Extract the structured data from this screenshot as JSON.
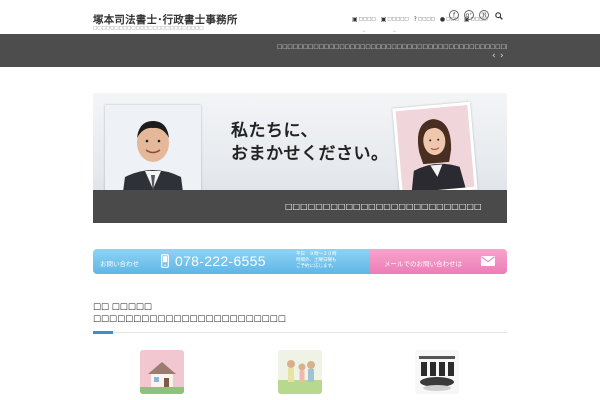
{
  "header": {
    "site_title": "塚本司法書士･行政書士事務所",
    "site_tagline": "□□□□□□□□□□□□□□□□□□□□□□□□□□",
    "nav": [
      {
        "label": "□□□□",
        "icon": "briefcase-icon",
        "glyph": "▣"
      },
      {
        "label": "□□□□□",
        "icon": "briefcase-icon",
        "glyph": "▣"
      },
      {
        "label": "□□□□",
        "icon": "question-icon",
        "glyph": "?"
      },
      {
        "label": "□□□",
        "icon": "info-icon",
        "glyph": "●"
      },
      {
        "label": "□□□□",
        "icon": "briefcase-icon",
        "glyph": "▣"
      }
    ],
    "social": [
      {
        "name": "facebook-icon",
        "glyph": "f"
      },
      {
        "name": "google-plus-icon",
        "glyph": "g⁺"
      },
      {
        "name": "rss-icon",
        "glyph": "ℜ"
      }
    ]
  },
  "banner": {
    "text": "□□□□□□□□□□□□□□□□□□□□□□□□□□□□□□□□□□□□□□□□□□□□□□□ □□□□□□□□□□",
    "prev": "‹",
    "next": "›"
  },
  "hero": {
    "message_line1": "私たちに、",
    "message_line2": "おまかせください。",
    "caption": "□□□□□□□□□□□□□□□□□□□□□□□□□□"
  },
  "contact": {
    "label": "お問い合わせ",
    "phone": "078-222-6555",
    "hours_line1": "平日　９時〜２０時",
    "hours_line2": "時間外、土曜日曜も",
    "hours_line3": "ご予約に応じます。",
    "mail_label": "メールでのお問い合わせは"
  },
  "section": {
    "title_line1": "□□ □□□□□",
    "title_line2": "□□□□□□□□□□□□□□□□□□□□□□□□"
  },
  "colors": {
    "banner": "#4d4d4d",
    "contact_blue": "#5fb6e6",
    "contact_pink": "#ec7eb7",
    "accent": "#3d8fd1"
  }
}
